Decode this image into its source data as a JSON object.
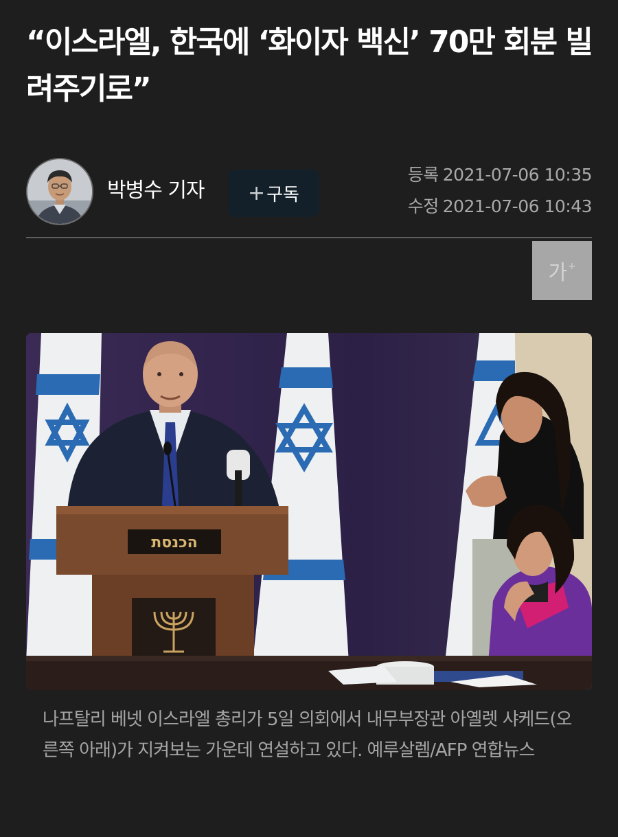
{
  "article": {
    "headline": "“이스라엘, 한국에 ‘화이자 백신’ 70만 회분 빌려주기로”",
    "reporter": {
      "name": "박병수 기자",
      "subscribe_plus": "+",
      "subscribe_label": "구독"
    },
    "dates": {
      "registered_label": "등록",
      "registered_value": "2021-07-06 10:35",
      "modified_label": "수정",
      "modified_value": "2021-07-06 10:43"
    },
    "font_size_button": {
      "label": "가",
      "plus": "+"
    },
    "photo": {
      "podium_sign": "הכנסת",
      "caption": "나프탈리 베넷 이스라엘 총리가 5일 의회에서 내무부장관 아옐렛 샤케드(오른쪽 아래)가 지켜보는 가운데 연설하고 있다. 예루살렘/AFP 연합뉴스"
    }
  },
  "colors": {
    "background": "#1e1e1f",
    "headline": "#ffffff",
    "meta_text": "#a9a9a9",
    "subscribe_button": "#13202a",
    "divider": "#5f5f5f",
    "font_size_button": "#a7a7a7"
  },
  "icons": [
    "reporter-avatar",
    "plus-icon",
    "font-size-icon"
  ]
}
